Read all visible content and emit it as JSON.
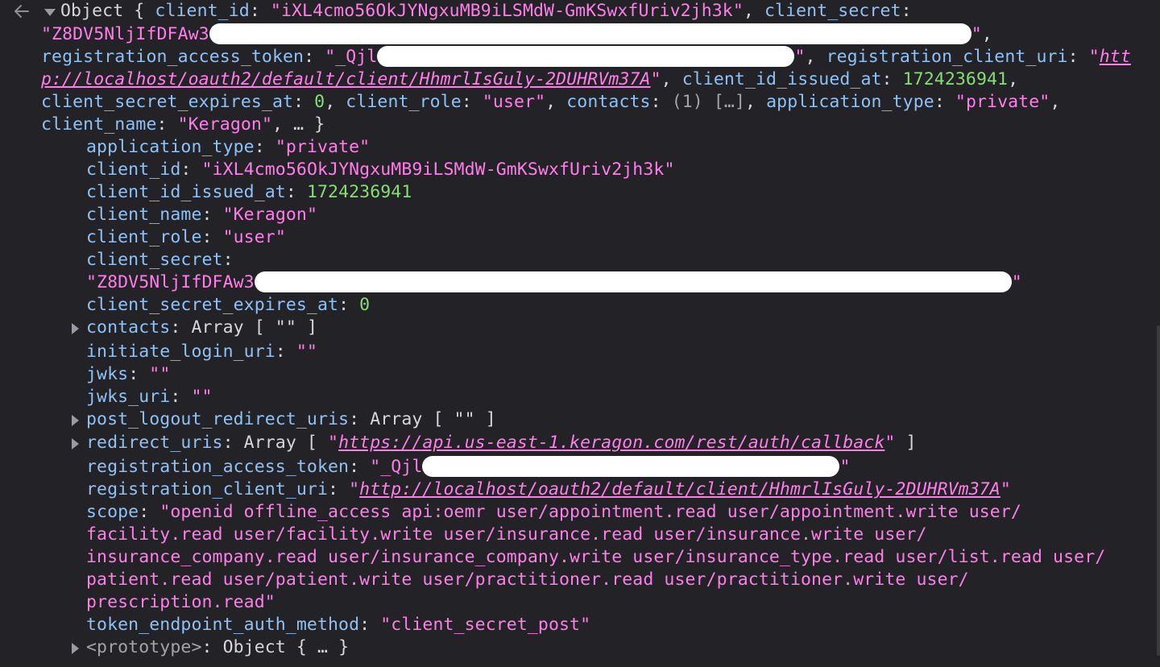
{
  "summary": {
    "object_label": "Object",
    "client_id_value": "\"iXL4cmo56OkJYNgxuMB9iLSMdW-GmKSwxfUriv2jh3k\"",
    "client_secret_visible": "\"Z8DV5NljIfDFAw3",
    "reg_token_visible": "\"_Qjl",
    "reg_client_uri_part1": "htt",
    "reg_client_uri_part2": "p://localhost/oauth2/default/client/HhmrlIsGuly-2DUHRVm37A",
    "client_id_issued_at": "1724236941",
    "client_secret_expires_at": "0",
    "client_role": "\"user\"",
    "contacts_preview": "(1) […]",
    "application_type": "\"private\"",
    "client_name": "\"Keragon\"",
    "ellipsis": "… }"
  },
  "props": {
    "application_type": "\"private\"",
    "client_id": "\"iXL4cmo56OkJYNgxuMB9iLSMdW-GmKSwxfUriv2jh3k\"",
    "client_id_issued_at": "1724236941",
    "client_name": "\"Keragon\"",
    "client_role": "\"user\"",
    "client_secret_visible": "\"Z8DV5NljIfDFAw3",
    "client_secret_expires_at": "0",
    "contacts": "Array [ \"\" ]",
    "initiate_login_uri": "\"\"",
    "jwks": "\"\"",
    "jwks_uri": "\"\"",
    "post_logout_redirect_uris": "Array [ \"\" ]",
    "redirect_uri_link": "https://api.us-east-1.keragon.com/rest/auth/callback",
    "registration_access_token_visible": "\"_Qjl",
    "registration_client_uri_link": "http://localhost/oauth2/default/client/HhmrlIsGuly-2DUHRVm37A",
    "scope_lines": [
      "\"openid offline_access api:oemr user/appointment.read user/appointment.write user/",
      "facility.read user/facility.write user/insurance.read user/insurance.write user/",
      "insurance_company.read user/insurance_company.write user/insurance_type.read user/list.read user/",
      "patient.read user/patient.write user/practitioner.read user/practitioner.write user/",
      "prescription.read\""
    ],
    "token_endpoint_auth_method": "\"client_secret_post\"",
    "prototype": "Object { … }"
  },
  "icons": {
    "back": "arrow-left-icon",
    "expanded": "triangle-down-icon",
    "collapsed": "triangle-right-icon"
  },
  "colors": {
    "background": "#232327",
    "key": "#8fc1f5",
    "string": "#ff7de9",
    "number": "#86de74"
  }
}
